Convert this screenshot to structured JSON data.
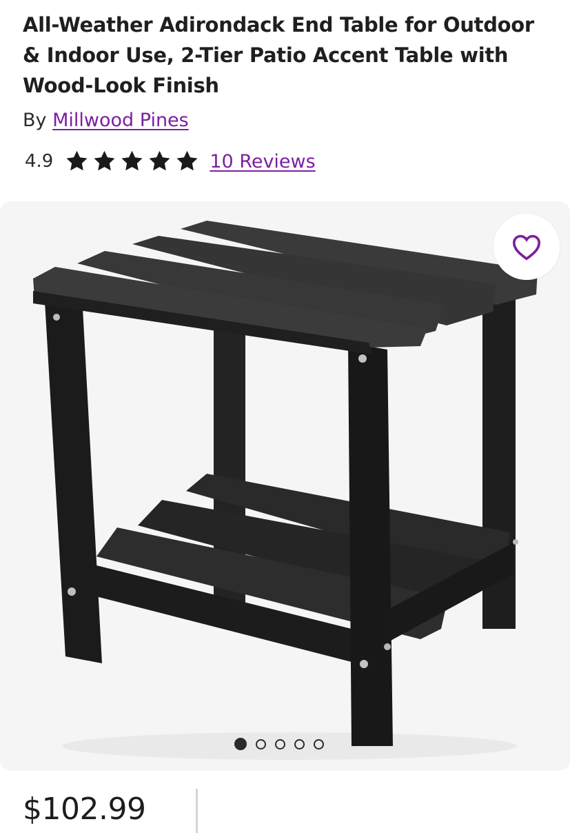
{
  "product": {
    "title": "All-Weather Adirondack End Table for Outdoor & Indoor Use, 2-Tier Patio Accent Table with Wood-Look Finish",
    "by_label": "By",
    "brand": "Millwood Pines",
    "rating": "4.9",
    "stars_filled": 5,
    "stars_total": 5,
    "reviews_link": "10 Reviews",
    "price": "$102.99"
  },
  "gallery": {
    "image_count": 5,
    "active_index": 0,
    "image_subject": "black two-tier slatted end table"
  },
  "icons": {
    "favorite": "heart-outline-icon",
    "star": "star-icon"
  },
  "colors": {
    "link": "#7b1fa2",
    "star": "#1a1a1a",
    "gallery_bg": "#f5f5f5",
    "heart": "#7b1fa2"
  }
}
